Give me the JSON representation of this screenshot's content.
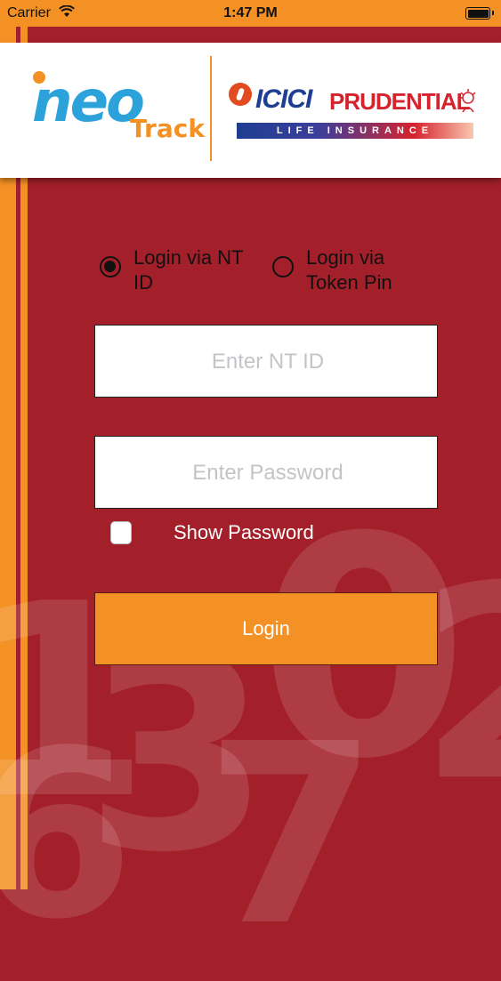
{
  "status_bar": {
    "carrier": "Carrier",
    "time": "1:47 PM",
    "icons": [
      "wifi-icon",
      "battery-icon"
    ]
  },
  "header": {
    "app_logo": {
      "neo": "neo",
      "track": "Track"
    },
    "partner_logo": {
      "brand": "ICICI",
      "name": "PRUDENTIAL",
      "tagline": "LIFE INSURANCE"
    }
  },
  "login_mode": {
    "options": [
      {
        "label": "Login via NT ID",
        "selected": true
      },
      {
        "label": "Login via Token Pin",
        "selected": false
      }
    ]
  },
  "form": {
    "nt_id": {
      "value": "",
      "placeholder": "Enter NT ID"
    },
    "password": {
      "value": "",
      "placeholder": "Enter Password"
    },
    "show_password": {
      "label": "Show Password",
      "checked": false
    },
    "login_label": "Login"
  },
  "background": {
    "watermark_digits": [
      "1",
      "3",
      "0",
      "2",
      "6",
      "7"
    ]
  },
  "colors": {
    "background": "#a3202a",
    "accent_orange": "#f39125",
    "brand_blue": "#2ba3da",
    "prudential_red": "#d5232e",
    "icici_blue": "#1e3e92"
  }
}
